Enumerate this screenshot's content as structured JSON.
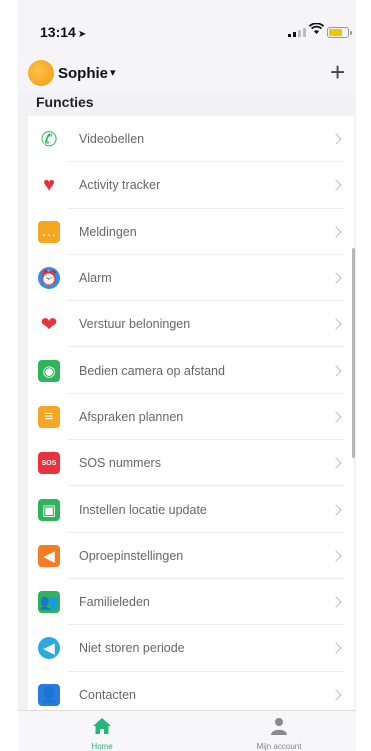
{
  "status_bar": {
    "time": "13:14",
    "location_arrow": "➤"
  },
  "header": {
    "user_name": "Sophie",
    "caret": "▾",
    "add_label": "+"
  },
  "section": {
    "title": "Functies"
  },
  "menu": [
    {
      "label": "Videobellen",
      "icon": "phone-icon",
      "glyph": "✆",
      "color": "#2fb35b"
    },
    {
      "label": "Activity tracker",
      "icon": "heart-icon",
      "glyph": "♥",
      "color": "#e8323c"
    },
    {
      "label": "Meldingen",
      "icon": "chat-bubble-icon",
      "glyph": "…",
      "color": "#f5a623"
    },
    {
      "label": "Alarm",
      "icon": "alarm-clock-icon",
      "glyph": "⏰",
      "color": "#2a8ff0"
    },
    {
      "label": "Verstuur beloningen",
      "icon": "hearts-icon",
      "glyph": "❤",
      "color": "#e8323c"
    },
    {
      "label": "Bedien camera op afstand",
      "icon": "camera-icon",
      "glyph": "◉",
      "color": "#2fb35b"
    },
    {
      "label": "Afspraken plannen",
      "icon": "calendar-list-icon",
      "glyph": "≡",
      "color": "#f5a623"
    },
    {
      "label": "SOS nummers",
      "icon": "sos-icon",
      "glyph": "SOS",
      "color": "#e8323c"
    },
    {
      "label": "Instellen locatie update",
      "icon": "location-update-icon",
      "glyph": "▣",
      "color": "#2fb35b"
    },
    {
      "label": "Oproepinstellingen",
      "icon": "speaker-icon",
      "glyph": "◀",
      "color": "#f57c23"
    },
    {
      "label": "Familieleden",
      "icon": "family-icon",
      "glyph": "👥",
      "color": "#2fb35b"
    },
    {
      "label": "Niet storen periode",
      "icon": "do-not-disturb-icon",
      "glyph": "◀",
      "color": "#2aa8e0"
    },
    {
      "label": "Contacten",
      "icon": "contacts-icon",
      "glyph": "👤",
      "color": "#2a7ae0"
    }
  ],
  "tabbar": {
    "home_label": "Home",
    "account_label": "Mijn account"
  },
  "colors": {
    "accent": "#25b67a"
  }
}
